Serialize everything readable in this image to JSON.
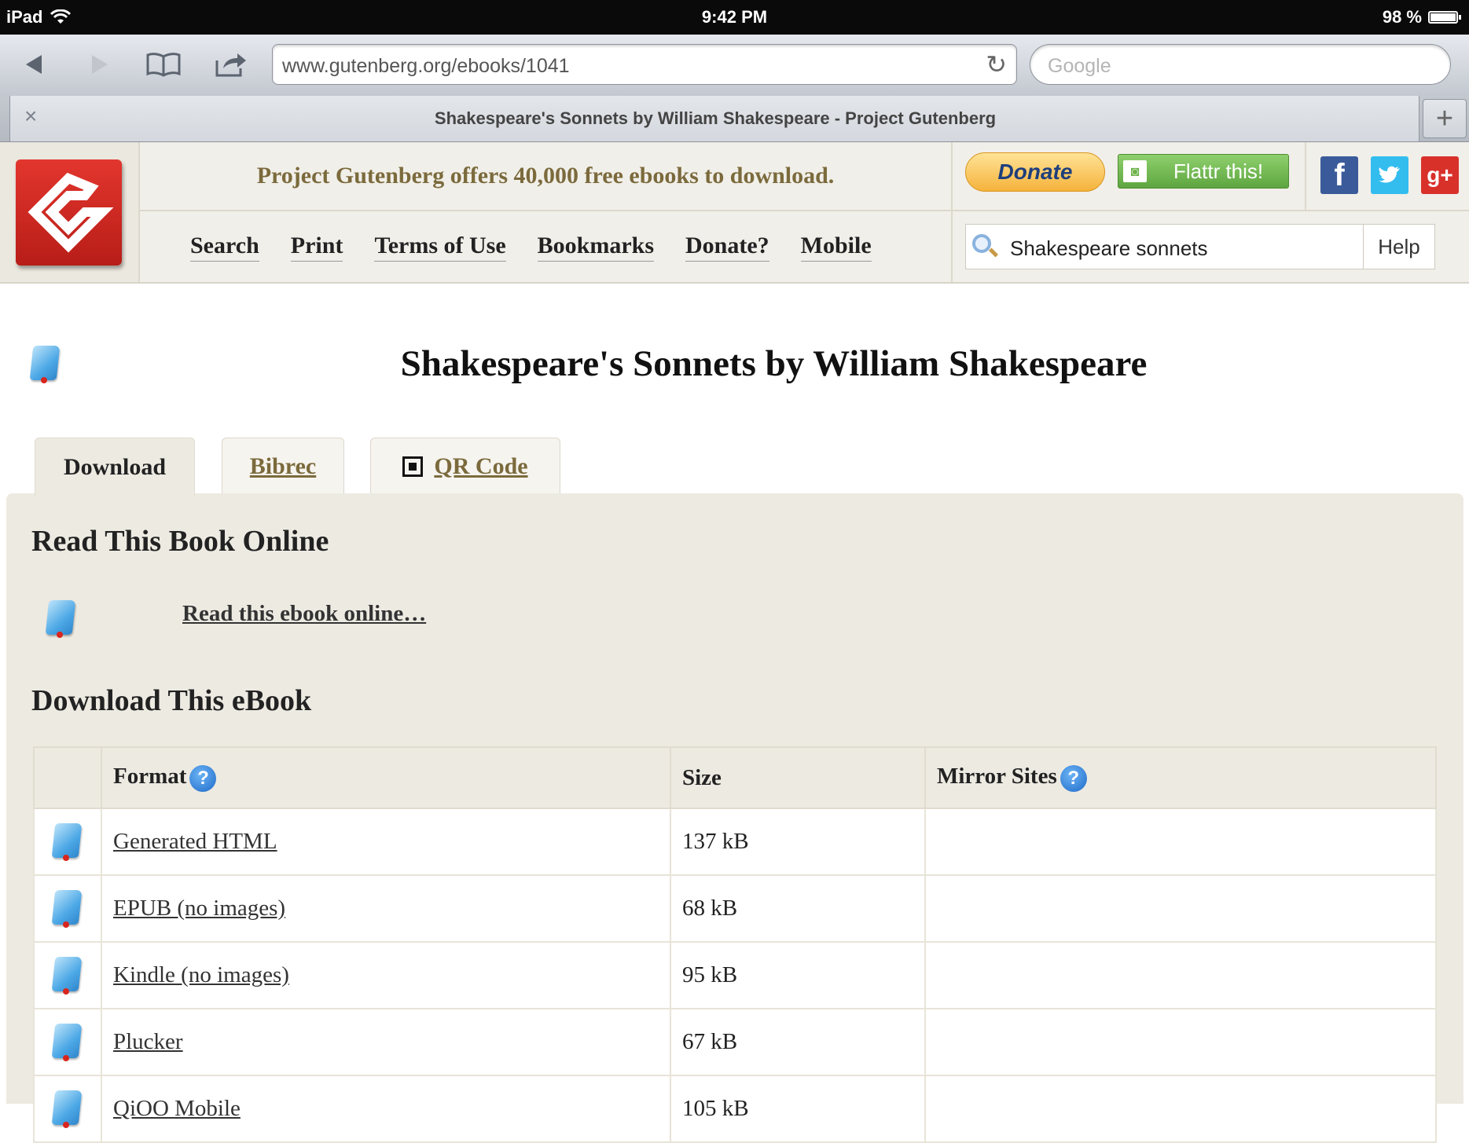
{
  "status_bar": {
    "device": "iPad",
    "time": "9:42 PM",
    "battery": "98 %",
    "battery_level": 0.98
  },
  "browser": {
    "url": "www.gutenberg.org/ebooks/1041",
    "search_placeholder": "Google",
    "tab_title": "Shakespeare's Sonnets by William Shakespeare - Project Gutenberg",
    "tab_close": "×",
    "tab_add": "+"
  },
  "site": {
    "tagline": "Project Gutenberg offers 40,000 free ebooks to download.",
    "nav": [
      "Search",
      "Print",
      "Terms of Use",
      "Bookmarks",
      "Donate?",
      "Mobile"
    ],
    "donate_label": "Donate",
    "flattr_label": "Flattr this!",
    "social": [
      "f",
      "t",
      "g+"
    ],
    "search_value": "Shakespeare sonnets",
    "search_help": "Help"
  },
  "page": {
    "title": "Shakespeare's Sonnets by William Shakespeare",
    "tabs": [
      "Download",
      "Bibrec",
      "QR Code"
    ],
    "read_heading": "Read This Book Online",
    "read_link": "Read this ebook online…",
    "download_heading": "Download This eBook",
    "table": {
      "headers": [
        "Format",
        "Size",
        "Mirror Sites"
      ],
      "rows": [
        {
          "format": "Generated HTML",
          "size": "137 kB",
          "mirror": ""
        },
        {
          "format": "EPUB (no images)",
          "size": "68 kB",
          "mirror": ""
        },
        {
          "format": "Kindle (no images)",
          "size": "95 kB",
          "mirror": ""
        },
        {
          "format": "Plucker",
          "size": "67 kB",
          "mirror": ""
        },
        {
          "format": "QiOO Mobile",
          "size": "105 kB",
          "mirror": ""
        }
      ]
    }
  },
  "colors": {
    "panel": "#edeae2",
    "tagline": "#7b6a3c",
    "logo_red": "#c8241d"
  }
}
